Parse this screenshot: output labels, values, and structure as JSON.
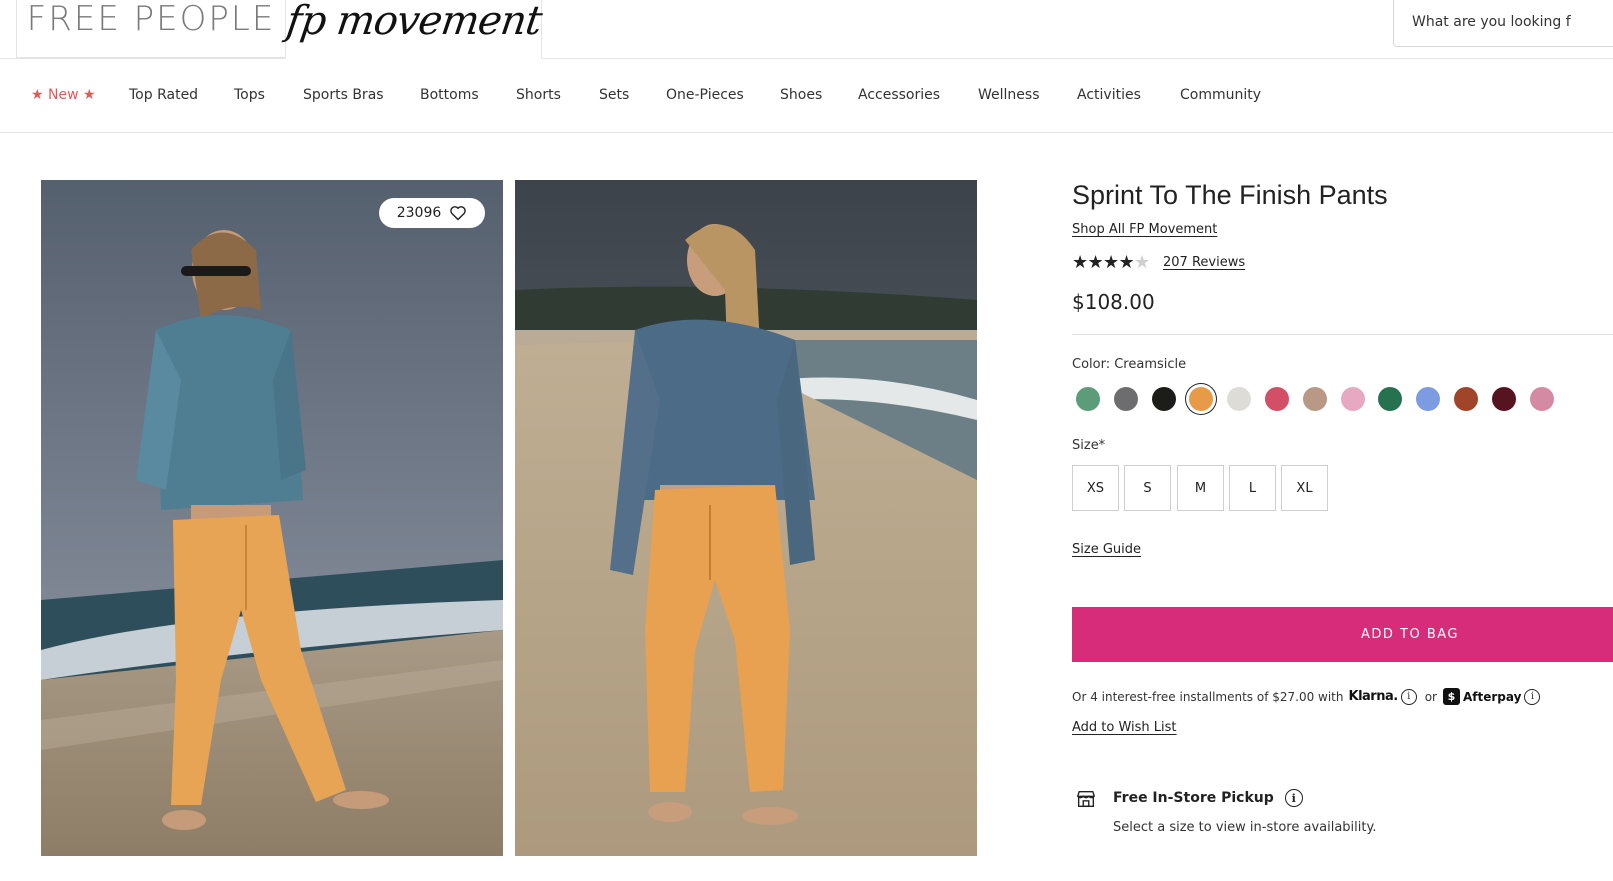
{
  "header": {
    "brand_left": "FREE PEOPLE",
    "brand_right": "fp movement",
    "search_placeholder": "What are you looking f"
  },
  "nav": {
    "items": [
      "★ New ★",
      "Top Rated",
      "Tops",
      "Sports Bras",
      "Bottoms",
      "Shorts",
      "Sets",
      "One-Pieces",
      "Shoes",
      "Accessories",
      "Wellness",
      "Activities",
      "Community"
    ]
  },
  "gallery": {
    "favorites_count": "23096"
  },
  "product": {
    "title": "Sprint To The Finish Pants",
    "shop_all": "Shop All FP Movement",
    "rating": 4,
    "rating_max": 5,
    "reviews": "207 Reviews",
    "price": "$108.00",
    "color_label": "Color: Creamsicle",
    "swatches": [
      {
        "color": "#5c9c78"
      },
      {
        "color": "#6d6d6f"
      },
      {
        "color": "#1c1c19"
      },
      {
        "color": "#e79a48",
        "selected": true
      },
      {
        "color": "#dedcd6"
      },
      {
        "color": "#d24f66"
      },
      {
        "color": "#b99886"
      },
      {
        "color": "#e7a8c1"
      },
      {
        "color": "#257150"
      },
      {
        "color": "#7c9be0"
      },
      {
        "color": "#a1452a"
      },
      {
        "color": "#561420"
      },
      {
        "color": "#d58aa3"
      }
    ],
    "size_label": "Size*",
    "sizes": [
      "XS",
      "S",
      "M",
      "L",
      "XL"
    ],
    "size_guide": "Size Guide",
    "add_to_bag": "ADD TO BAG",
    "installments_text": "Or 4 interest-free installments of $27.00 with",
    "klarna": "Klarna.",
    "or": "or",
    "afterpay": "Afterpay",
    "wish_list": "Add to Wish List",
    "pickup_title": "Free In-Store Pickup",
    "pickup_sub": "Select a size to view in-store availability."
  },
  "colors": {
    "accent": "#d62c7a",
    "new_nav": "#e05a5a"
  }
}
